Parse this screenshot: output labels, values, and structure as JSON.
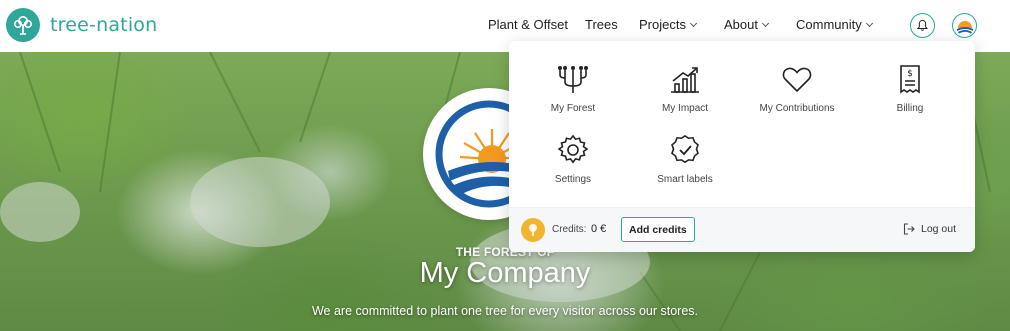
{
  "brand": {
    "name": "tree-nation",
    "color": "#2fa69a",
    "logo_icon": "tree-logo-icon"
  },
  "nav": {
    "items": [
      {
        "label": "Plant & Offset",
        "has_caret": false
      },
      {
        "label": "Trees",
        "has_caret": false
      },
      {
        "label": "Projects",
        "has_caret": true
      },
      {
        "label": "About",
        "has_caret": true
      },
      {
        "label": "Community",
        "has_caret": true
      }
    ],
    "notification_icon": "bell-icon",
    "profile_icon": "avatar-icon"
  },
  "hero": {
    "kicker": "THE FOREST OF",
    "title": "My Company",
    "subtitle": "We are committed to plant one tree for every visitor across our stores."
  },
  "menu": {
    "items": [
      {
        "label": "My Forest",
        "icon": "forest-icon"
      },
      {
        "label": "My Impact",
        "icon": "impact-chart-icon"
      },
      {
        "label": "My Contributions",
        "icon": "heart-icon"
      },
      {
        "label": "Billing",
        "icon": "receipt-icon"
      },
      {
        "label": "Settings",
        "icon": "gear-icon"
      },
      {
        "label": "Smart labels",
        "icon": "check-badge-icon"
      }
    ],
    "footer": {
      "credits_label": "Credits:",
      "credits_value": "0 €",
      "add_credits_label": "Add credits",
      "logout_label": "Log out"
    }
  },
  "colors": {
    "accent": "#2fa69a",
    "coin": "#f2b531"
  }
}
